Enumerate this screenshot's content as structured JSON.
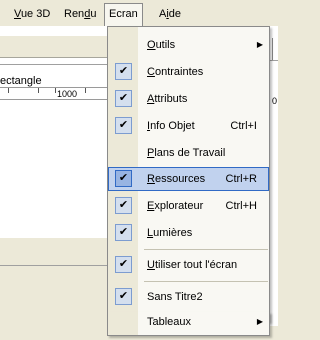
{
  "menubar": {
    "items": [
      {
        "label": "Vue 3D"
      },
      {
        "label": "Rendu"
      },
      {
        "label": "Ecran"
      },
      {
        "label": "Aide"
      }
    ]
  },
  "background": {
    "rect_label": "ectangle",
    "ruler_label": "1000",
    "ruler_label_right": "0"
  },
  "dropdown": {
    "items": [
      {
        "label": "Outils",
        "checked": false,
        "shortcut": "",
        "submenu": true
      },
      {
        "label": "Contraintes",
        "checked": true,
        "shortcut": "",
        "submenu": false
      },
      {
        "label": "Attributs",
        "checked": true,
        "shortcut": "",
        "submenu": false
      },
      {
        "label": "Info Objet",
        "checked": true,
        "shortcut": "Ctrl+I",
        "submenu": false
      },
      {
        "label": "Plans de Travail",
        "checked": false,
        "shortcut": "",
        "submenu": false
      },
      {
        "label": "Ressources",
        "checked": true,
        "shortcut": "Ctrl+R",
        "submenu": false,
        "highlighted": true
      },
      {
        "label": "Explorateur",
        "checked": true,
        "shortcut": "Ctrl+H",
        "submenu": false
      },
      {
        "label": "Lumières",
        "checked": true,
        "shortcut": "",
        "submenu": false
      },
      {
        "label": "Utiliser tout l'écran",
        "checked": true,
        "shortcut": "",
        "submenu": false
      },
      {
        "label": "Sans Titre2",
        "checked": true,
        "shortcut": "",
        "submenu": false
      },
      {
        "label": "Tableaux",
        "checked": false,
        "shortcut": "",
        "submenu": true
      }
    ],
    "check_glyph": "✔",
    "arrow_glyph": "▶"
  },
  "colors": {
    "highlight_bg": "#c1d2ee",
    "highlight_border": "#316ac5",
    "menu_bg": "#f9f8f3",
    "gutter_bg": "#ece9d8"
  }
}
